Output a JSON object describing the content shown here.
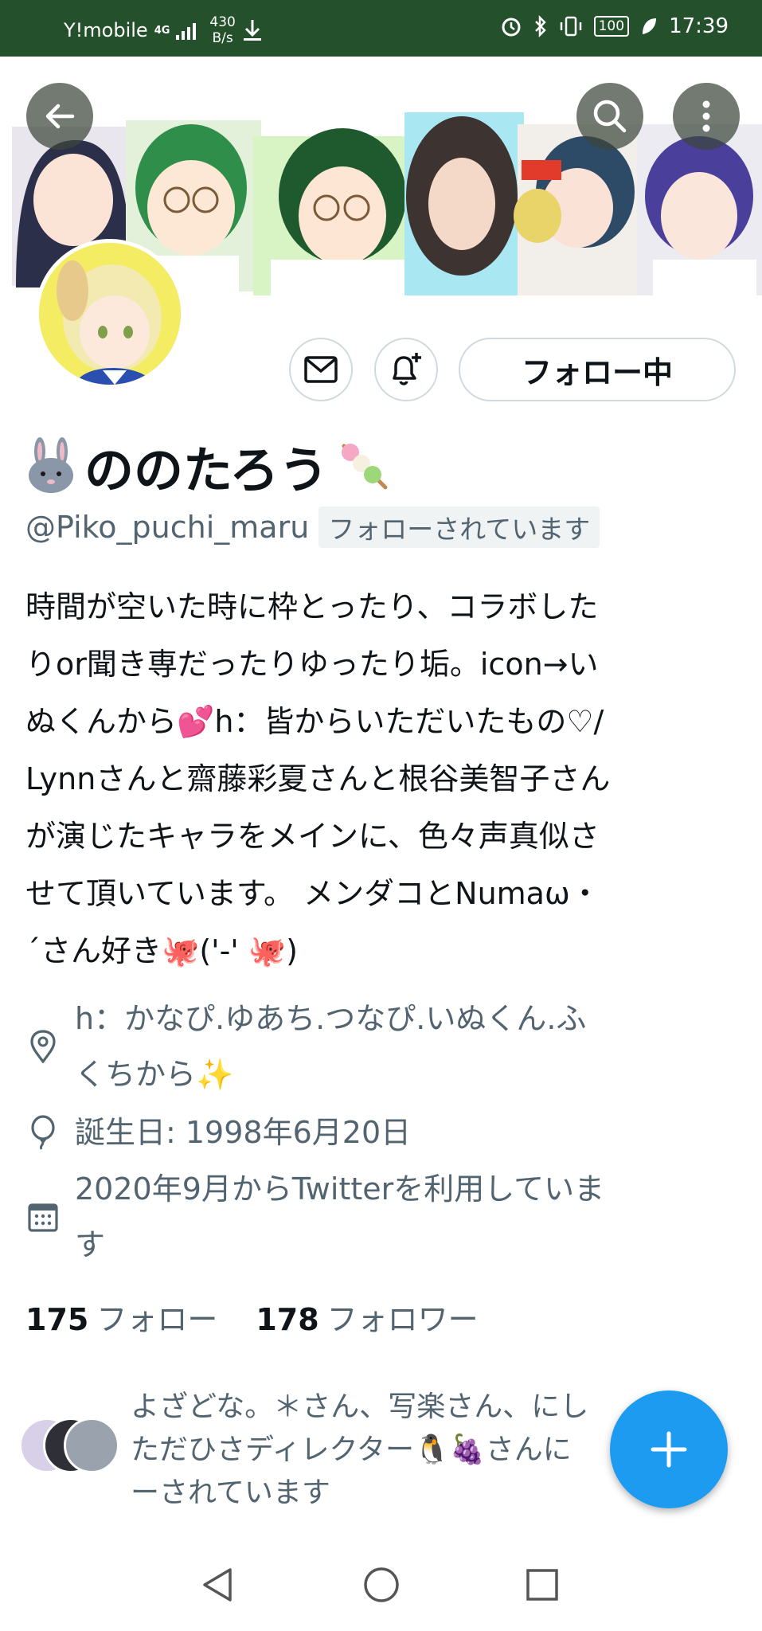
{
  "status_bar": {
    "carrier": "Y!mobile",
    "network": "4G",
    "speed_value": "430",
    "speed_unit": "B/s",
    "battery": "100",
    "time": "17:39"
  },
  "profile": {
    "display_name": "ののたろう",
    "handle": "@Piko_puchi_maru",
    "follows_you": "フォローされています",
    "follow_button": "フォロー中",
    "bio_lines": [
      "時間が空いた時に枠とったり、コラボした",
      "りor聞き専だったりゆったり垢。icon→い",
      "ぬくんから💕h：皆からいただいたもの♡/",
      "Lynnさんと齋藤彩夏さんと根谷美智子さん",
      "が演じたキャラをメインに、色々声真似さ",
      "せて頂いています。 メンダコとNumaω・",
      "´さん好き🐙('-' 🐙)"
    ],
    "location_lines": [
      "h：かなぴ.ゆあち.つなぴ.いぬくん.ふ",
      "くちから✨"
    ],
    "birthday": "誕生日: 1998年6月20日",
    "joined_lines": [
      "2020年9月からTwitterを利用していま",
      "す"
    ],
    "following_count": "175",
    "following_label": "フォロー",
    "followers_count": "178",
    "followers_label": "フォロワー",
    "followed_by_lines": [
      "よざどな。＊さん、写楽さん、にし",
      "ただひさディレクター🐧🍇さんに",
      "ーされています"
    ]
  },
  "colors": {
    "status_bar_bg": "#24502b",
    "accent": "#1d9bf0",
    "secondary_text": "#536471",
    "border": "#cfd9de"
  },
  "icons": {
    "back": "arrow-left-icon",
    "search": "search-icon",
    "more": "more-vertical-icon",
    "message": "envelope-icon",
    "notify": "bell-plus-icon",
    "location": "location-pin-icon",
    "birthday": "balloon-icon",
    "joined": "calendar-icon",
    "compose": "plus-icon"
  }
}
